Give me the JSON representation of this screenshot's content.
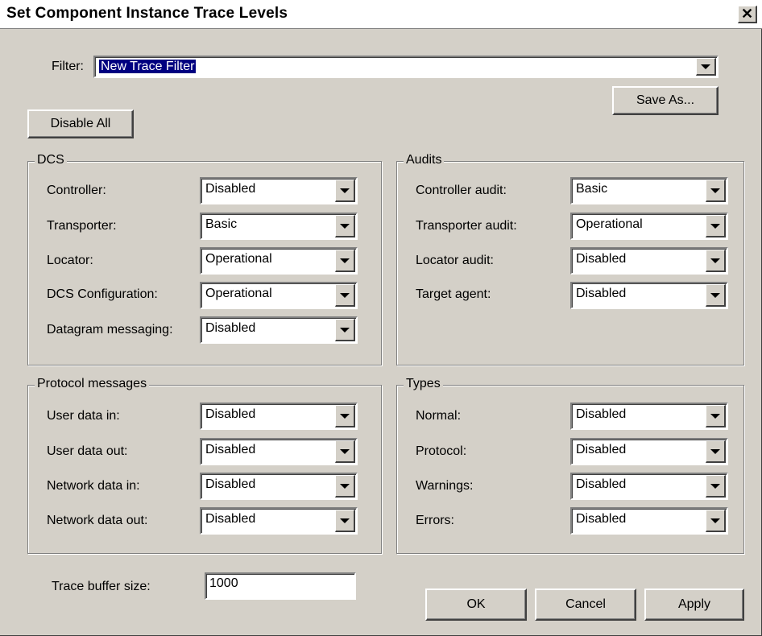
{
  "window": {
    "title": "Set Component Instance Trace Levels",
    "close_icon": "close-icon"
  },
  "filter": {
    "label": "Filter:",
    "value": "New Trace Filter"
  },
  "buttons": {
    "save_as": "Save As...",
    "disable_all": "Disable All",
    "ok": "OK",
    "cancel": "Cancel",
    "apply": "Apply"
  },
  "dcs": {
    "title": "DCS",
    "rows": [
      {
        "label": "Controller:",
        "value": "Disabled"
      },
      {
        "label": "Transporter:",
        "value": "Basic"
      },
      {
        "label": "Locator:",
        "value": "Operational"
      },
      {
        "label": "DCS Configuration:",
        "value": "Operational"
      },
      {
        "label": "Datagram messaging:",
        "value": "Disabled"
      }
    ]
  },
  "audits": {
    "title": "Audits",
    "rows": [
      {
        "label": "Controller audit:",
        "value": "Basic"
      },
      {
        "label": "Transporter audit:",
        "value": "Operational"
      },
      {
        "label": "Locator audit:",
        "value": "Disabled"
      },
      {
        "label": "Target agent:",
        "value": "Disabled"
      }
    ]
  },
  "protocol": {
    "title": "Protocol messages",
    "rows": [
      {
        "label": "User data in:",
        "value": "Disabled"
      },
      {
        "label": "User data out:",
        "value": "Disabled"
      },
      {
        "label": "Network data in:",
        "value": "Disabled"
      },
      {
        "label": "Network data out:",
        "value": "Disabled"
      }
    ]
  },
  "types": {
    "title": "Types",
    "rows": [
      {
        "label": "Normal:",
        "value": "Disabled"
      },
      {
        "label": "Protocol:",
        "value": "Disabled"
      },
      {
        "label": "Warnings:",
        "value": "Disabled"
      },
      {
        "label": "Errors:",
        "value": "Disabled"
      }
    ]
  },
  "trace_buffer": {
    "label": "Trace buffer size:",
    "value": "1000"
  }
}
